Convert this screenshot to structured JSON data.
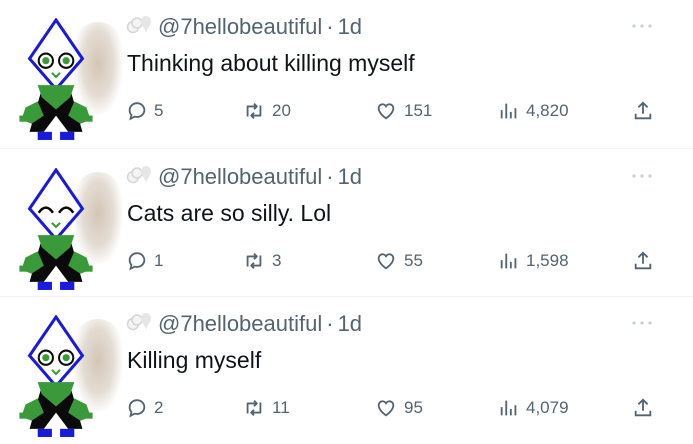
{
  "tweets": [
    {
      "handle": "@7hellobeautiful",
      "time": "1d",
      "text": "Thinking about killing myself",
      "replies": "5",
      "retweets": "20",
      "likes": "151",
      "views": "4,820",
      "eyes": "open"
    },
    {
      "handle": "@7hellobeautiful",
      "time": "1d",
      "text": "Cats are so silly. Lol",
      "replies": "1",
      "retweets": "3",
      "likes": "55",
      "views": "1,598",
      "eyes": "smiling"
    },
    {
      "handle": "@7hellobeautiful",
      "time": "1d",
      "text": "Killing myself",
      "replies": "2",
      "retweets": "11",
      "likes": "95",
      "views": "4,079",
      "eyes": "open"
    }
  ],
  "dot_separator": "·",
  "colors": {
    "text": "#0f1419",
    "secondary": "#536471",
    "character_outline": "#1a1adb",
    "character_green": "#3a9a3a",
    "character_body": "#0a0a0a"
  },
  "icons": [
    "reply-icon",
    "retweet-icon",
    "like-icon",
    "views-icon",
    "share-icon",
    "more-icon"
  ]
}
